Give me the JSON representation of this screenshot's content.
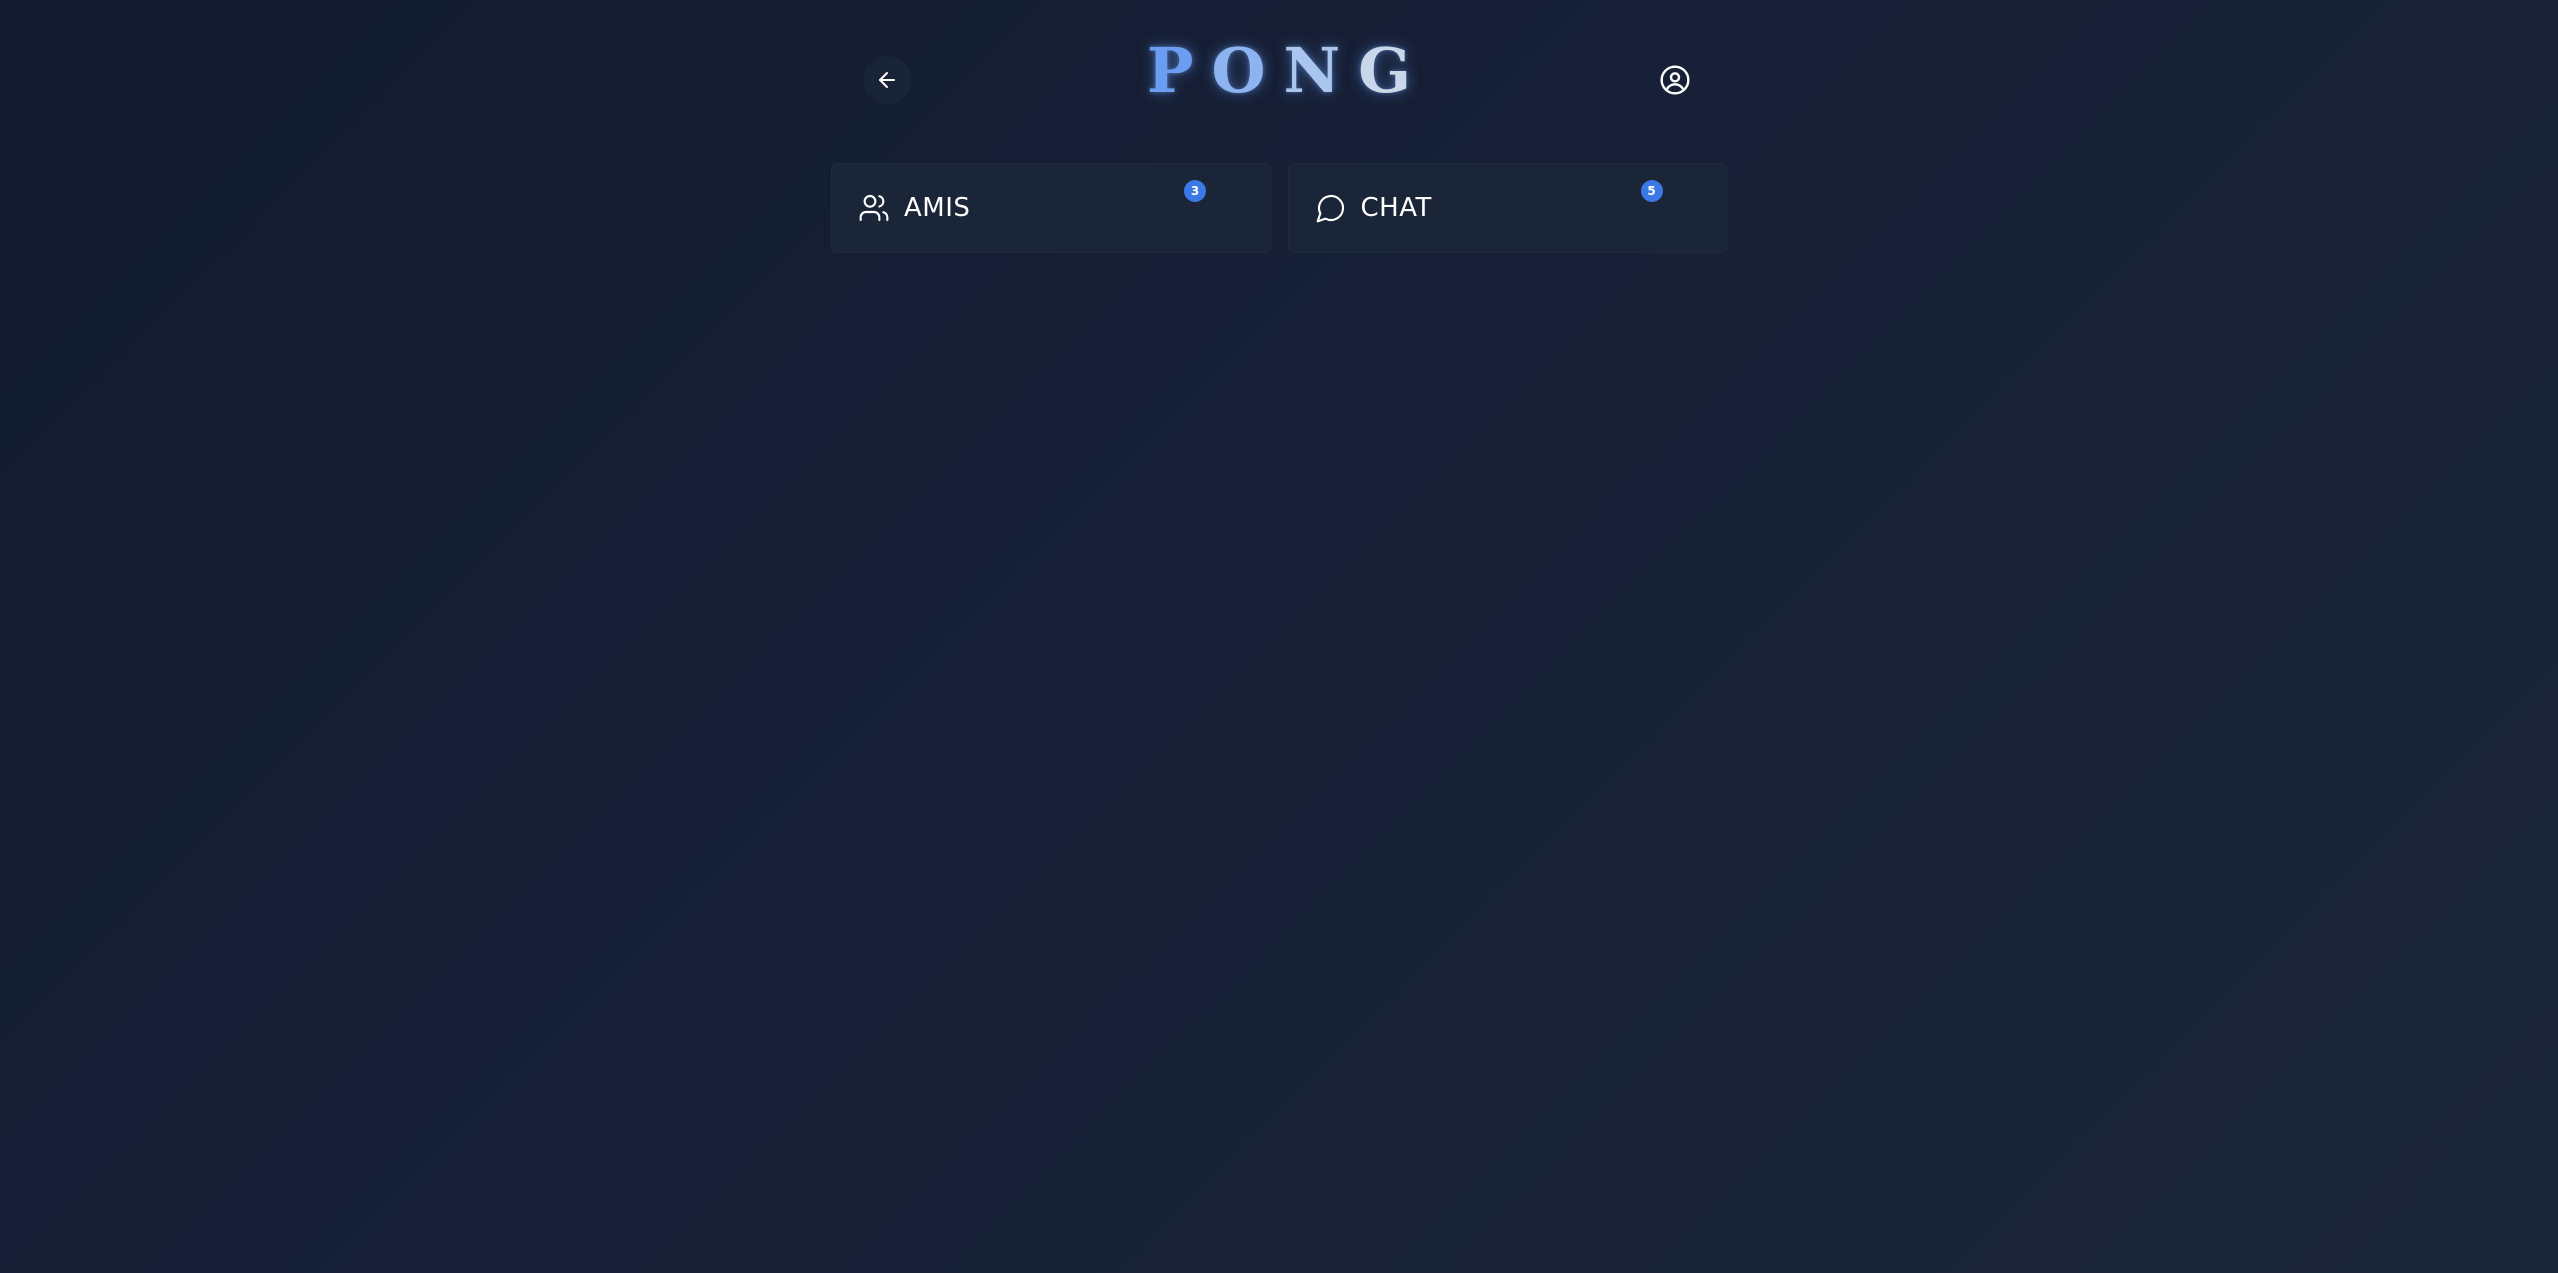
{
  "header": {
    "logo_letters": [
      "P",
      "O",
      "N",
      "G"
    ],
    "logo_colors": [
      "#6b9ef0",
      "#8db4f0",
      "#aac6ee",
      "#c8d8ea"
    ],
    "back_icon": "arrow-left-icon",
    "profile_icon": "user-circle-icon"
  },
  "cards": [
    {
      "label": "AMIS",
      "icon": "users-icon",
      "badge": "3"
    },
    {
      "label": "CHAT",
      "icon": "message-circle-icon",
      "badge": "5"
    }
  ],
  "colors": {
    "accent": "#3b7ae6",
    "card_bg": "#1b2538",
    "page_bg": "#151e32"
  }
}
